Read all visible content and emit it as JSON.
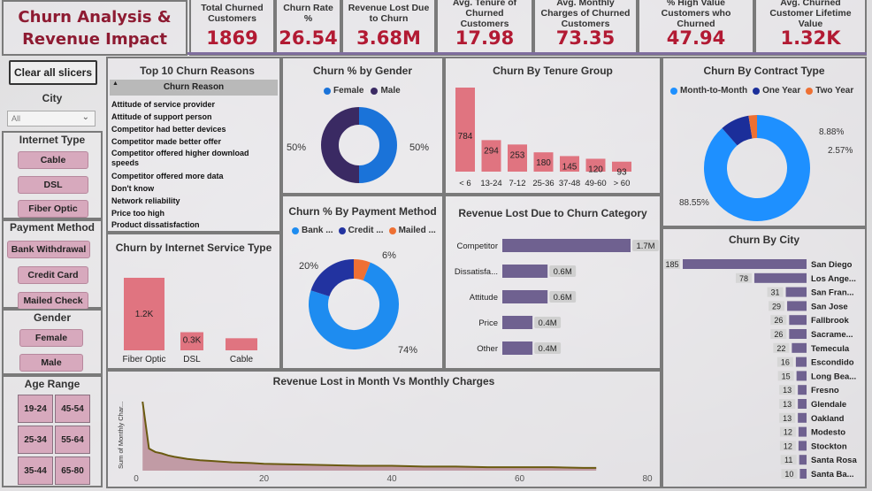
{
  "title": "Churn Analysis & Revenue Impact",
  "kpis": [
    {
      "label": "Total Churned Customers",
      "value": "1869"
    },
    {
      "label": "Churn Rate %",
      "value": "26.54"
    },
    {
      "label": "Revenue Lost Due to Churn",
      "value": "3.68M"
    },
    {
      "label": "Avg. Tenure of Churned Customers",
      "value": "17.98"
    },
    {
      "label": "Avg. Monthly Charges of Churned Customers",
      "value": "73.35"
    },
    {
      "label": "% High Value Customers who Churned",
      "value": "47.94"
    },
    {
      "label": "Avg. Churned Customer Lifetime Value",
      "value": "1.32K"
    }
  ],
  "slicers": {
    "clear_label": "Clear all slicers",
    "city_title": "City",
    "city_selected": "All",
    "internet_title": "Internet Type",
    "internet_options": [
      "Cable",
      "DSL",
      "Fiber Optic"
    ],
    "payment_title": "Payment Method",
    "payment_options": [
      "Bank Withdrawal",
      "Credit Card",
      "Mailed Check"
    ],
    "gender_title": "Gender",
    "gender_options": [
      "Female",
      "Male"
    ],
    "age_title": "Age Range",
    "age_options": [
      "19-24",
      "45-54",
      "25-34",
      "55-64",
      "35-44",
      "65-80"
    ]
  },
  "reasons": {
    "title": "Top 10 Churn Reasons",
    "column": "Churn Reason",
    "sort_arrow": "▲",
    "rows": [
      "Attitude of service provider",
      "Attitude of support person",
      "Competitor had better devices",
      "Competitor made better offer",
      "Competitor offered higher download speeds",
      "Competitor offered more data",
      "Don't know",
      "Network reliability",
      "Price too high",
      "Product dissatisfaction"
    ]
  },
  "colors": {
    "female": "#1a73d9",
    "male": "#3a2a63",
    "bank": "#1e8cf0",
    "credit": "#2233a0",
    "mailed": "#ee7033",
    "m2m": "#1e90ff",
    "oneyear": "#1b2e9a",
    "twoyear": "#ee7033",
    "bar_red": "#e07480",
    "bar_purple": "#6f6190",
    "title_red": "#8e1b32",
    "kpi_red": "#b21a33"
  },
  "chart_data": [
    {
      "type": "pie",
      "title": "Churn % by Gender",
      "legend": [
        "Female",
        "Male"
      ],
      "values": [
        50,
        50
      ],
      "labels": [
        "50%",
        "50%"
      ]
    },
    {
      "type": "bar",
      "title": "Churn By Tenure Group",
      "categories": [
        "< 6",
        "13-24",
        "7-12",
        "25-36",
        "37-48",
        "49-60",
        "> 60"
      ],
      "values": [
        784,
        294,
        253,
        180,
        145,
        120,
        93
      ]
    },
    {
      "type": "pie",
      "title": "Churn By Contract Type",
      "legend": [
        "Month-to-Month",
        "One Year",
        "Two Year"
      ],
      "values": [
        88.55,
        8.88,
        2.57
      ],
      "labels": [
        "88.55%",
        "8.88%",
        "2.57%"
      ]
    },
    {
      "type": "bar",
      "title": "Churn by Internet Service Type",
      "categories": [
        "Fiber Optic",
        "DSL",
        "Cable"
      ],
      "values": [
        1.2,
        0.3,
        0.2
      ],
      "labels": [
        "1.2K",
        "0.3K",
        ""
      ]
    },
    {
      "type": "pie",
      "title": "Churn % By Payment Method",
      "legend": [
        "Bank ...",
        "Credit ...",
        "Mailed ..."
      ],
      "values": [
        74,
        20,
        6
      ],
      "labels": [
        "74%",
        "20%",
        "6%"
      ]
    },
    {
      "type": "bar",
      "title": "Revenue Lost Due to Churn Category",
      "categories": [
        "Competitor",
        "Dissatisfa...",
        "Attitude",
        "Price",
        "Other"
      ],
      "values": [
        1.7,
        0.6,
        0.6,
        0.4,
        0.4
      ],
      "labels": [
        "1.7M",
        "0.6M",
        "0.6M",
        "0.4M",
        "0.4M"
      ]
    },
    {
      "type": "bar",
      "title": "Churn By City",
      "categories": [
        "San Diego",
        "Los Ange...",
        "San Fran...",
        "San Jose",
        "Fallbrook",
        "Sacrame...",
        "Temecula",
        "Escondido",
        "Long Bea...",
        "Fresno",
        "Glendale",
        "Oakland",
        "Modesto",
        "Stockton",
        "Santa Rosa",
        "Santa Ba..."
      ],
      "values": [
        185,
        78,
        31,
        29,
        26,
        26,
        22,
        16,
        15,
        13,
        13,
        13,
        12,
        12,
        11,
        10
      ]
    },
    {
      "type": "area",
      "title": "Revenue Lost in Month Vs Monthly Charges",
      "ylabel": "Sum of Monthly Char...",
      "xlim": [
        0,
        80
      ],
      "xticks": [
        0,
        20,
        40,
        60,
        80
      ],
      "x": [
        1,
        2,
        3,
        4,
        5,
        6,
        8,
        10,
        12,
        15,
        18,
        20,
        25,
        30,
        35,
        40,
        45,
        50,
        55,
        60,
        65,
        70,
        72
      ],
      "values": [
        100,
        32,
        27,
        25,
        22,
        20,
        17,
        15,
        14,
        12,
        11,
        10,
        9,
        8,
        7,
        7,
        6,
        6,
        5,
        5,
        5,
        4,
        4
      ]
    }
  ]
}
